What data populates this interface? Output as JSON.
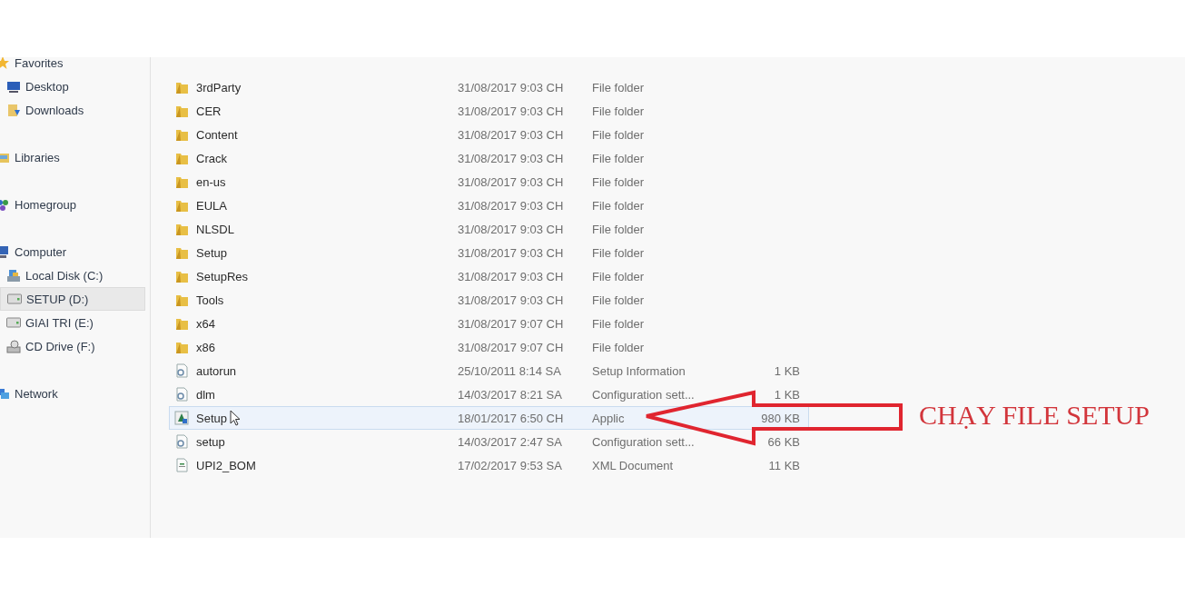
{
  "sidebar": [
    {
      "label": "Favorites",
      "kind": "star",
      "selected": false,
      "children": [
        {
          "label": "Desktop",
          "kind": "desktop",
          "selected": false
        },
        {
          "label": "Downloads",
          "kind": "downloads",
          "selected": false
        }
      ]
    },
    {
      "label": "Libraries",
      "kind": "libraries",
      "selected": false
    },
    {
      "label": "Homegroup",
      "kind": "homegroup",
      "selected": false
    },
    {
      "label": "Computer",
      "kind": "computer",
      "selected": false,
      "children": [
        {
          "label": "Local Disk (C:)",
          "kind": "disk",
          "selected": false
        },
        {
          "label": "SETUP (D:)",
          "kind": "drive",
          "selected": true
        },
        {
          "label": "GIAI TRI (E:)",
          "kind": "drive",
          "selected": false
        },
        {
          "label": "CD Drive (F:)",
          "kind": "cd",
          "selected": false
        }
      ]
    },
    {
      "label": "Network",
      "kind": "network",
      "selected": false
    }
  ],
  "files": [
    {
      "name": "3rdParty",
      "kind": "folder",
      "date": "31/08/2017 9:03 CH",
      "type": "File folder",
      "selected": false
    },
    {
      "name": "CER",
      "kind": "folder",
      "date": "31/08/2017 9:03 CH",
      "type": "File folder",
      "selected": false
    },
    {
      "name": "Content",
      "kind": "folder",
      "date": "31/08/2017 9:03 CH",
      "type": "File folder",
      "selected": false
    },
    {
      "name": "Crack",
      "kind": "folder",
      "date": "31/08/2017 9:03 CH",
      "type": "File folder",
      "selected": false
    },
    {
      "name": "en-us",
      "kind": "folder",
      "date": "31/08/2017 9:03 CH",
      "type": "File folder",
      "selected": false
    },
    {
      "name": "EULA",
      "kind": "folder",
      "date": "31/08/2017 9:03 CH",
      "type": "File folder",
      "selected": false
    },
    {
      "name": "NLSDL",
      "kind": "folder",
      "date": "31/08/2017 9:03 CH",
      "type": "File folder",
      "selected": false
    },
    {
      "name": "Setup",
      "kind": "folder",
      "date": "31/08/2017 9:03 CH",
      "type": "File folder",
      "selected": false
    },
    {
      "name": "SetupRes",
      "kind": "folder",
      "date": "31/08/2017 9:03 CH",
      "type": "File folder",
      "selected": false
    },
    {
      "name": "Tools",
      "kind": "folder",
      "date": "31/08/2017 9:03 CH",
      "type": "File folder",
      "selected": false
    },
    {
      "name": "x64",
      "kind": "folder",
      "date": "31/08/2017 9:07 CH",
      "type": "File folder",
      "selected": false
    },
    {
      "name": "x86",
      "kind": "folder",
      "date": "31/08/2017 9:07 CH",
      "type": "File folder",
      "selected": false
    },
    {
      "name": "autorun",
      "kind": "config",
      "date": "25/10/2011 8:14 SA",
      "type": "Setup Information",
      "size": "1 KB",
      "selected": false
    },
    {
      "name": "dlm",
      "kind": "config",
      "date": "14/03/2017 8:21 SA",
      "type": "Configuration sett...",
      "size": "1 KB",
      "selected": false
    },
    {
      "name": "Setup",
      "kind": "app",
      "date": "18/01/2017 6:50 CH",
      "type": "Applic",
      "size": "980 KB",
      "selected": true
    },
    {
      "name": "setup",
      "kind": "config",
      "date": "14/03/2017 2:47 SA",
      "type": "Configuration sett...",
      "size": "66 KB",
      "selected": false
    },
    {
      "name": "UPI2_BOM",
      "kind": "xml",
      "date": "17/02/2017 9:53 SA",
      "type": "XML Document",
      "size": "11 KB",
      "selected": false
    }
  ],
  "annotation": {
    "label": "CHẠY FILE SETUP"
  }
}
